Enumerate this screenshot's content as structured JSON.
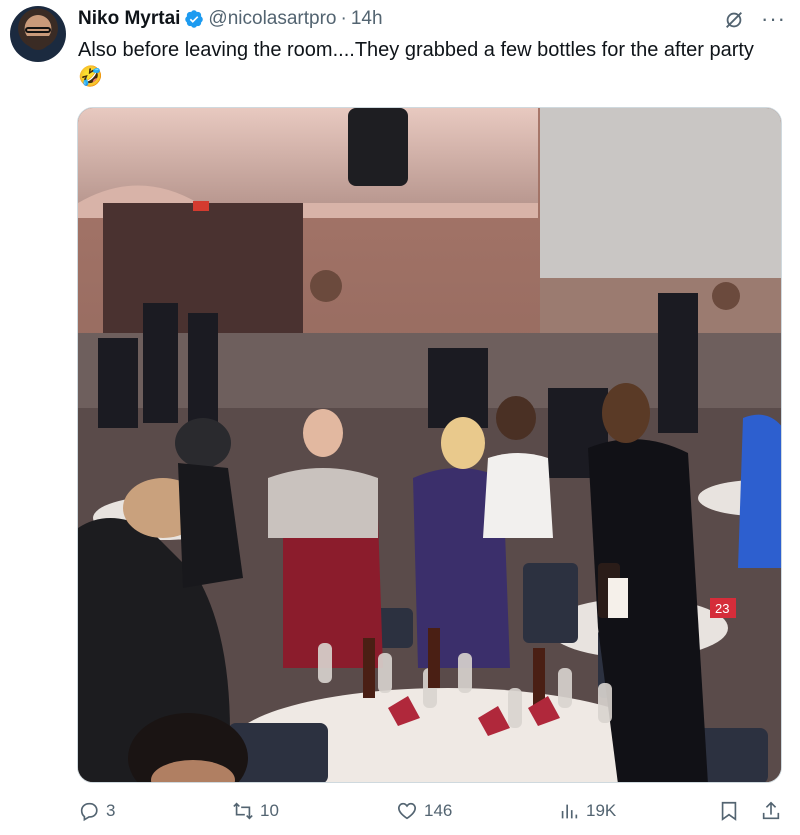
{
  "tweet": {
    "author_name": "Niko Myrtai",
    "handle": "@nicolasartpro",
    "separator": "·",
    "time": "14h",
    "text": "Also before leaving the room....They grabbed a few bottles for the after party 🤣",
    "more_label": "···"
  },
  "metrics": {
    "replies": "3",
    "reposts": "10",
    "likes": "146",
    "views": "19K"
  },
  "media": {
    "table_number": "23"
  },
  "colors": {
    "verified": "#1d9bf0",
    "muted": "#536471",
    "text": "#0f1419"
  },
  "icons": [
    "avatar",
    "verified-badge-icon",
    "grok-icon",
    "more-icon",
    "reply-icon",
    "repost-icon",
    "like-icon",
    "views-icon",
    "bookmark-icon",
    "share-icon"
  ]
}
